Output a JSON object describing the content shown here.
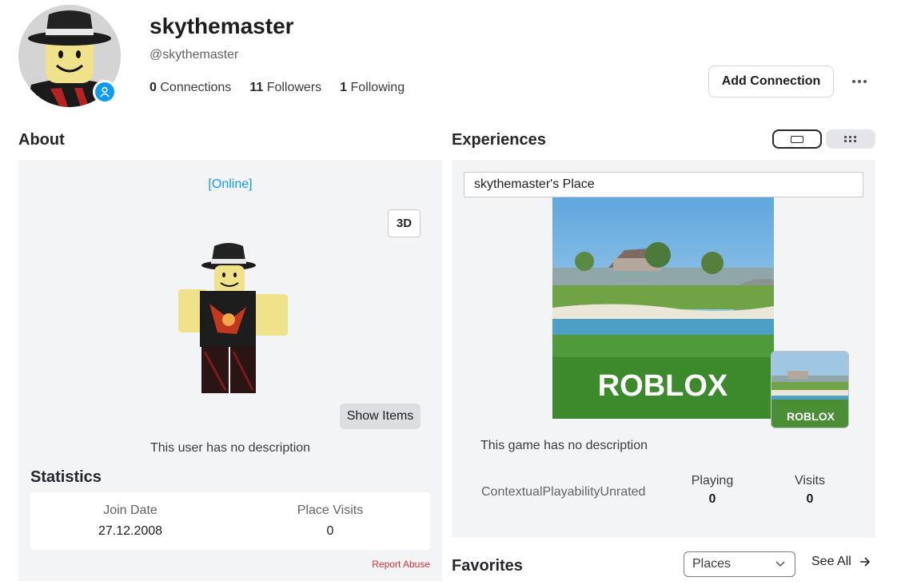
{
  "profile": {
    "display_name": "skythemaster",
    "username": "@skythemaster",
    "connections_count": "0",
    "connections_label": "Connections",
    "followers_count": "11",
    "followers_label": "Followers",
    "following_count": "1",
    "following_label": "Following",
    "add_connection_label": "Add Connection"
  },
  "about": {
    "heading": "About",
    "status": "[Online]",
    "view_3d_label": "3D",
    "show_items_label": "Show Items",
    "description": "This user has no description",
    "statistics_heading": "Statistics",
    "join_date_label": "Join Date",
    "join_date_value": "27.12.2008",
    "place_visits_label": "Place Visits",
    "place_visits_value": "0",
    "report_abuse_label": "Report Abuse"
  },
  "experiences": {
    "heading": "Experiences",
    "place_title": "skythemaster's Place",
    "logo_text": "ROBLOX",
    "description": "This game has no description",
    "rating": "ContextualPlayabilityUnrated",
    "playing_label": "Playing",
    "playing_value": "0",
    "visits_label": "Visits",
    "visits_value": "0"
  },
  "favorites": {
    "heading": "Favorites",
    "filter_selected": "Places",
    "see_all_label": "See All"
  },
  "colors": {
    "online": "#0f9bf1",
    "report": "#d63232",
    "panel_bg": "#f2f4f5"
  }
}
